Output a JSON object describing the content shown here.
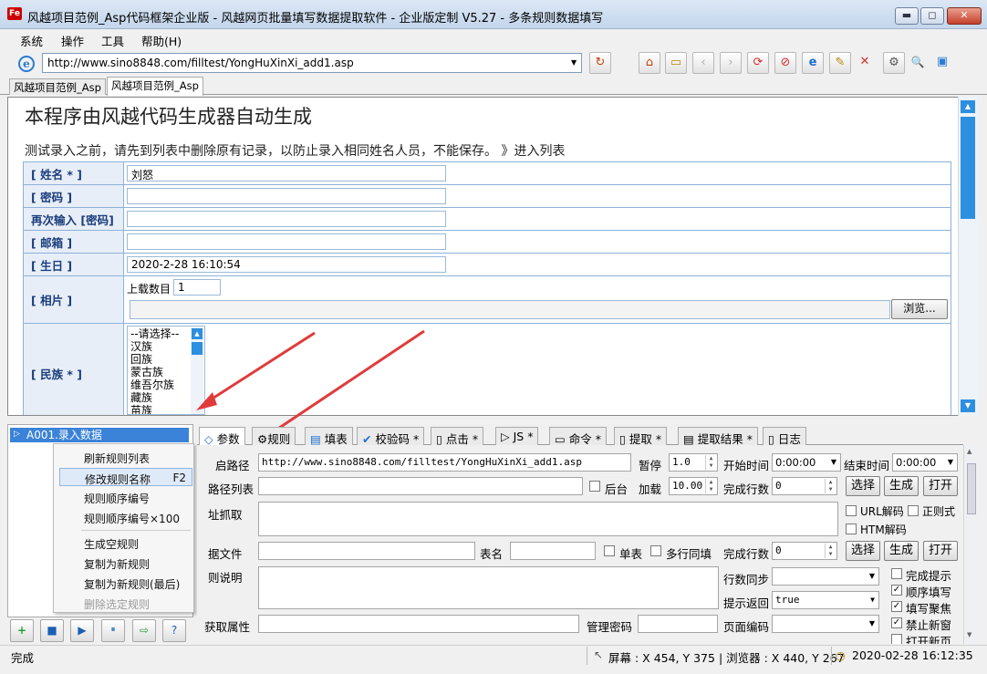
{
  "window": {
    "title": "风越项目范例_Asp代码框架企业版 - 风越网页批量填写数据提取软件 - 企业版定制 V5.27 - 多条规则数据填写",
    "icon_text": "Fe",
    "min": "▬",
    "max": "◻",
    "close": "✕"
  },
  "menubar": {
    "items": [
      "系统",
      "操作",
      "工具",
      "帮助(H)"
    ]
  },
  "address": {
    "url": "http://www.sino8848.com/filltest/YongHuXinXi_add1.asp",
    "ie_icon": "e",
    "dropdown_arrow": "▼"
  },
  "toolbar_icons": [
    {
      "name": "refresh-icon",
      "glyph": "↻"
    },
    {
      "name": "home-icon",
      "glyph": "⌂"
    },
    {
      "name": "folder-icon",
      "glyph": "▭"
    },
    {
      "name": "back-icon",
      "glyph": "‹"
    },
    {
      "name": "forward-icon",
      "glyph": "›"
    },
    {
      "name": "reload-icon",
      "glyph": "⟳"
    },
    {
      "name": "stop-icon",
      "glyph": "⊘"
    },
    {
      "name": "ie-browser-icon",
      "glyph": "e"
    },
    {
      "name": "tools-icon",
      "glyph": "✎"
    },
    {
      "name": "close-page-icon",
      "glyph": "✕"
    },
    {
      "name": "settings-icon",
      "glyph": "⚙"
    },
    {
      "name": "zoom-icon",
      "glyph": "🔍"
    },
    {
      "name": "window-icon",
      "glyph": "▣"
    }
  ],
  "doc_tabs": [
    "风越项目范例_Asp",
    "风越项目范例_Asp"
  ],
  "web": {
    "title": "本程序由风越代码生成器自动生成",
    "notice": "测试录入之前，请先到列表中删除原有记录，以防止录入相同姓名人员，不能保存。 》进入列表",
    "fields": [
      {
        "label": "[ 姓名 * ]",
        "value": "刘怒"
      },
      {
        "label": "[ 密码 ]",
        "value": ""
      },
      {
        "label": "再次输入 [密码]",
        "value": ""
      },
      {
        "label": "[ 邮箱 ]",
        "value": ""
      },
      {
        "label": "[ 生日 ]",
        "value": "2020-2-28 16:10:54"
      }
    ],
    "photo_label": "[ 相片 ]",
    "upload_count_label": "上载数目",
    "upload_count_value": "1",
    "browse_button": "浏览...",
    "ethnic_label": "[ 民族 * ]",
    "ethnic_options": [
      "--请选择--",
      "汉族",
      "回族",
      "蒙古族",
      "维吾尔族",
      "藏族",
      "苗族"
    ]
  },
  "tree": {
    "item": "A001.录入数据"
  },
  "context_menu": {
    "items": [
      {
        "label": "刷新规则列表",
        "shortcut": ""
      },
      {
        "label": "修改规则名称",
        "shortcut": "F2"
      },
      {
        "label": "规则顺序编号",
        "shortcut": ""
      },
      {
        "label": "规则顺序编号×100",
        "shortcut": ""
      },
      {
        "label": "生成空规则",
        "shortcut": ""
      },
      {
        "label": "复制为新规则",
        "shortcut": ""
      },
      {
        "label": "复制为新规则(最后)",
        "shortcut": ""
      },
      {
        "label": "删除选定规则",
        "shortcut": ""
      }
    ]
  },
  "bottom_buttons": [
    {
      "name": "add-rule-icon",
      "glyph": "+"
    },
    {
      "name": "save-icon",
      "glyph": "■"
    },
    {
      "name": "run-icon",
      "glyph": "▶"
    },
    {
      "name": "pause-icon",
      "glyph": "⏸"
    },
    {
      "name": "export-icon",
      "glyph": "⇨"
    },
    {
      "name": "help-icon",
      "glyph": "?"
    }
  ],
  "rule_tabs": [
    {
      "name": "tab-params",
      "label": "参数",
      "glyph": "◇"
    },
    {
      "name": "tab-rules",
      "label": "规则",
      "glyph": "⚙"
    },
    {
      "name": "tab-fill-table",
      "label": "填表",
      "glyph": "▤"
    },
    {
      "name": "tab-captcha",
      "label": "校验码 *",
      "glyph": "✔"
    },
    {
      "name": "tab-click",
      "label": "点击 *",
      "glyph": "▯"
    },
    {
      "name": "tab-js",
      "label": "JS *",
      "glyph": "▷"
    },
    {
      "name": "tab-command",
      "label": "命令 *",
      "glyph": "▭"
    },
    {
      "name": "tab-extract",
      "label": "提取 *",
      "glyph": "▯"
    },
    {
      "name": "tab-extract-result",
      "label": "提取结果 *",
      "glyph": "▤"
    },
    {
      "name": "tab-log",
      "label": "日志",
      "glyph": "▯"
    }
  ],
  "panel": {
    "path_label": "启路径",
    "path_value": "http://www.sino8848.com/filltest/YongHuXinXi_add1.asp",
    "pause_label": "暂停",
    "pause_value": "1.0",
    "start_time_label": "开始时间",
    "start_time_value": "0:00:00",
    "end_time_label": "结束时间",
    "end_time_value": "0:00:00",
    "path_list_label": "路径列表",
    "background_label": "后台",
    "load_label": "加载",
    "load_value": "10.00",
    "done_rows_label": "完成行数",
    "done_rows_value": "0",
    "select_btn": "选择",
    "generate_btn": "生成",
    "open_btn": "打开",
    "url_fetch_label": "址抓取",
    "url_decode_label": "URL解码",
    "regex_label": "正则式",
    "html_decode_label": "HTM解码",
    "data_file_label": "据文件",
    "table_name_label": "表名",
    "single_table_label": "单表",
    "multirow_label": "多行同填",
    "done_rows2_label": "完成行数",
    "done_rows2_value": "0",
    "desc_label": "则说明",
    "row_sync_label": "行数同步",
    "row_sync_value": "",
    "done_prompt_label": "完成提示",
    "seq_fill_label": "顺序填写",
    "hint_return_label": "提示返回",
    "hint_return_value": "true",
    "fill_focus_label": "填写聚焦",
    "get_attr_label": "获取属性",
    "admin_pwd_label": "管理密码",
    "page_encoding_label": "页面编码",
    "page_encoding_value": "",
    "block_popup_label": "禁止新窗",
    "open_new_label": "打开新页"
  },
  "status": {
    "state": "完成",
    "coords": "屏幕 : X 454, Y 375 | 浏览器 : X 440, Y 267",
    "datetime": "2020-02-28 16:12:35"
  }
}
